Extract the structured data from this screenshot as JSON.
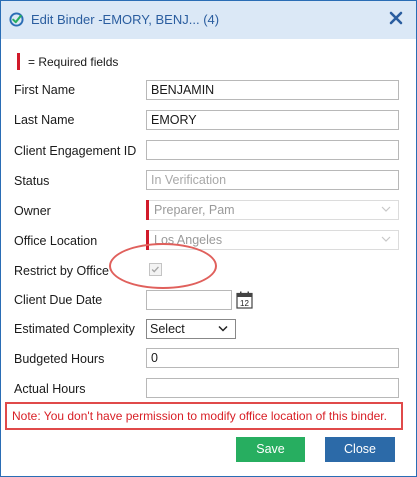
{
  "dialog": {
    "title": "Edit Binder -EMORY, BENJ... (4)",
    "required_note": "= Required fields"
  },
  "form": {
    "first_name": {
      "label": "First Name",
      "value": "BENJAMIN"
    },
    "last_name": {
      "label": "Last Name",
      "value": "EMORY"
    },
    "client_engagement_id": {
      "label": "Client Engagement ID",
      "value": ""
    },
    "status": {
      "label": "Status",
      "value": "In Verification"
    },
    "owner": {
      "label": "Owner",
      "value": "Preparer, Pam"
    },
    "office_location": {
      "label": "Office Location",
      "value": "Los Angeles"
    },
    "restrict_by_office": {
      "label": "Restrict by Office",
      "checked": true
    },
    "client_due_date": {
      "label": "Client Due Date",
      "value": "",
      "calendar_day": "12"
    },
    "estimated_complexity": {
      "label": "Estimated Complexity",
      "value": "Select"
    },
    "budgeted_hours": {
      "label": "Budgeted Hours",
      "value": "0"
    },
    "actual_hours": {
      "label": "Actual Hours",
      "value": ""
    }
  },
  "note": "Note: You don't have permission to modify office location of this binder.",
  "buttons": {
    "save": "Save",
    "close": "Close"
  },
  "colors": {
    "title_bg": "#dbe8f6",
    "title_text": "#2a5d9f",
    "required_marker": "#d11a2a",
    "save_button": "#27ae60",
    "close_button": "#2c6aa8",
    "note_text": "#d81f26",
    "highlight_outline": "#e04a4a"
  }
}
